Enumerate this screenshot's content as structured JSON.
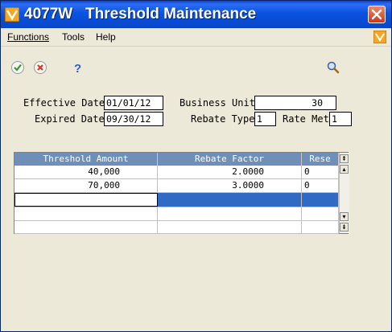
{
  "window": {
    "title": "4077W   Threshold Maintenance"
  },
  "menu": {
    "functions": "Functions",
    "tools": "Tools",
    "help": "Help"
  },
  "form": {
    "effective_date_label": "Effective Date",
    "effective_date_value": "01/01/12",
    "expired_date_label": "Expired Date",
    "expired_date_value": "09/30/12",
    "business_unit_label": "Business Unit",
    "business_unit_value": "30",
    "rebate_type_label": "Rebate Type",
    "rebate_type_value": "1",
    "rate_met_label": "Rate Met",
    "rate_met_value": "1"
  },
  "grid": {
    "columns": [
      "Threshold Amount",
      "Rebate Factor",
      "Rese"
    ],
    "rows": [
      {
        "amount": "40,000",
        "factor": "2.0000",
        "rese": "0"
      },
      {
        "amount": "70,000",
        "factor": "3.0000",
        "rese": "0"
      }
    ]
  },
  "colors": {
    "title_bar": "#0a53e0",
    "grid_header": "#6f8fb8",
    "selection": "#316ac5",
    "ok_icon": "#2e9b2e",
    "cancel_icon": "#d83a1e",
    "help_icon": "#2f5fc4"
  },
  "icons": [
    "app-icon",
    "close-icon",
    "ok-check-icon",
    "cancel-x-icon",
    "help-question-icon",
    "search-magnifier-icon",
    "menu-logo-icon"
  ]
}
